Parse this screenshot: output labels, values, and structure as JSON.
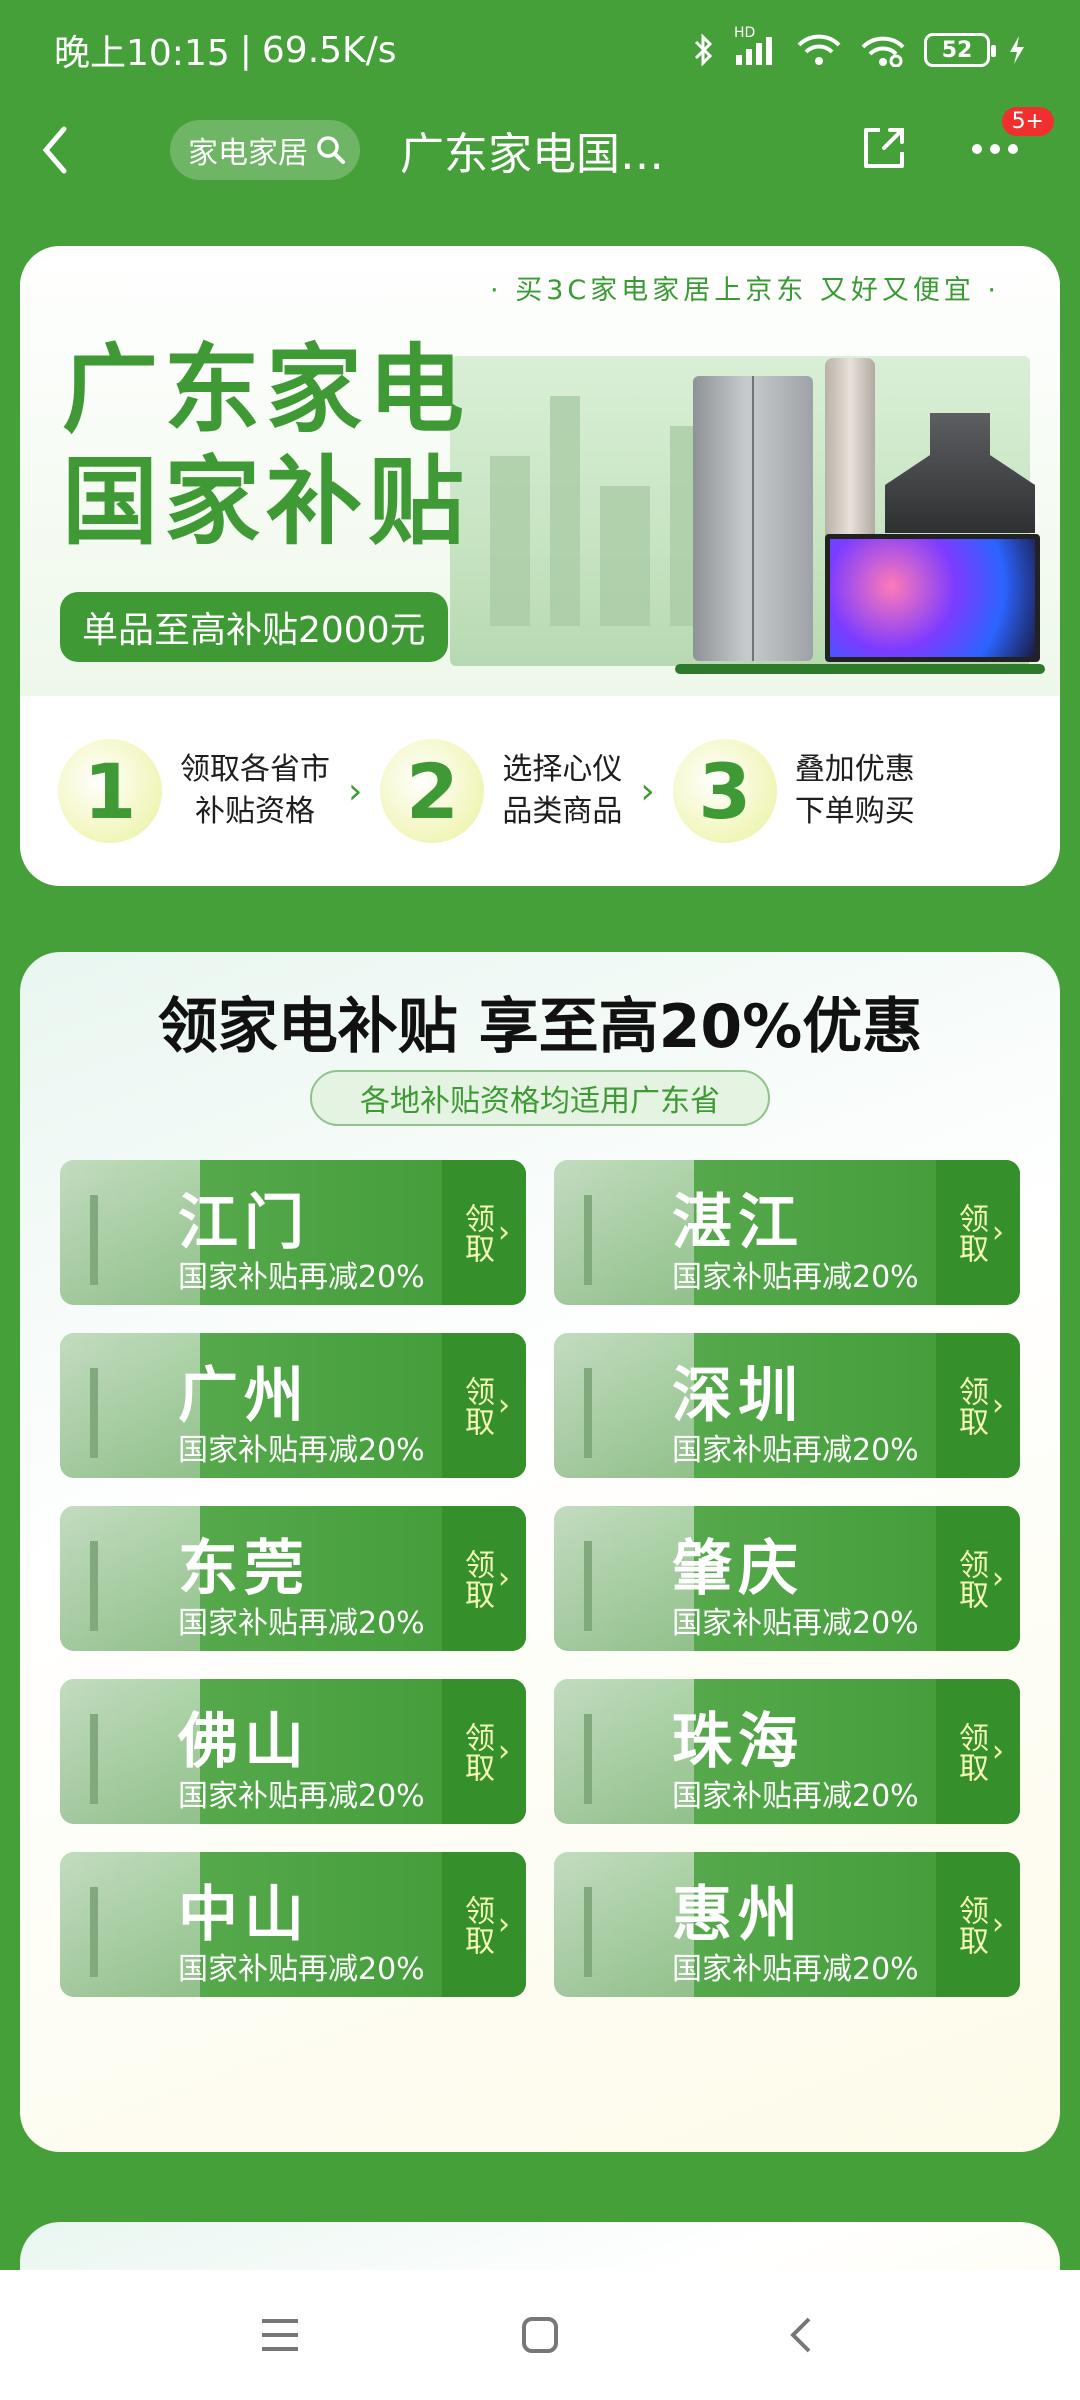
{
  "status_bar": {
    "time": "晚上10:15",
    "separator": "|",
    "speed": "69.5K/s",
    "network_label": "HD",
    "battery": "52",
    "icons": [
      "bluetooth-icon",
      "signal-icon",
      "wifi-icon",
      "hotspot-icon",
      "battery-icon",
      "charging-icon"
    ]
  },
  "nav": {
    "search_placeholder": "家电家居",
    "title": "广东家电国…",
    "badge": "5+"
  },
  "banner": {
    "tagline": "· 买3C家电家居上京东  又好又便宜 ·",
    "hero_line1": "广东家电",
    "hero_line2": "国家补贴",
    "hero_pill": "单品至高补贴2000元",
    "steps": [
      {
        "num": "1",
        "text": "领取各省市\n补贴资格"
      },
      {
        "num": "2",
        "text": "选择心仪\n品类商品"
      },
      {
        "num": "3",
        "text": "叠加优惠\n下单购买"
      }
    ]
  },
  "subsidy": {
    "title": "领家电补贴 享至高20%优惠",
    "subtitle": "各地补贴资格均适用广东省",
    "claim_label": "领取",
    "cities": [
      {
        "name": "江门",
        "sub": "国家补贴再减20%"
      },
      {
        "name": "湛江",
        "sub": "国家补贴再减20%"
      },
      {
        "name": "广州",
        "sub": "国家补贴再减20%"
      },
      {
        "name": "深圳",
        "sub": "国家补贴再减20%"
      },
      {
        "name": "东莞",
        "sub": "国家补贴再减20%"
      },
      {
        "name": "肇庆",
        "sub": "国家补贴再减20%"
      },
      {
        "name": "佛山",
        "sub": "国家补贴再减20%"
      },
      {
        "name": "珠海",
        "sub": "国家补贴再减20%"
      },
      {
        "name": "中山",
        "sub": "国家补贴再减20%"
      },
      {
        "name": "惠州",
        "sub": "国家补贴再减20%"
      }
    ]
  },
  "colors": {
    "brand_green": "#46a03a",
    "dark_green": "#35902c",
    "claim_text": "#f4f9b8",
    "badge_red": "#f12f2f"
  }
}
